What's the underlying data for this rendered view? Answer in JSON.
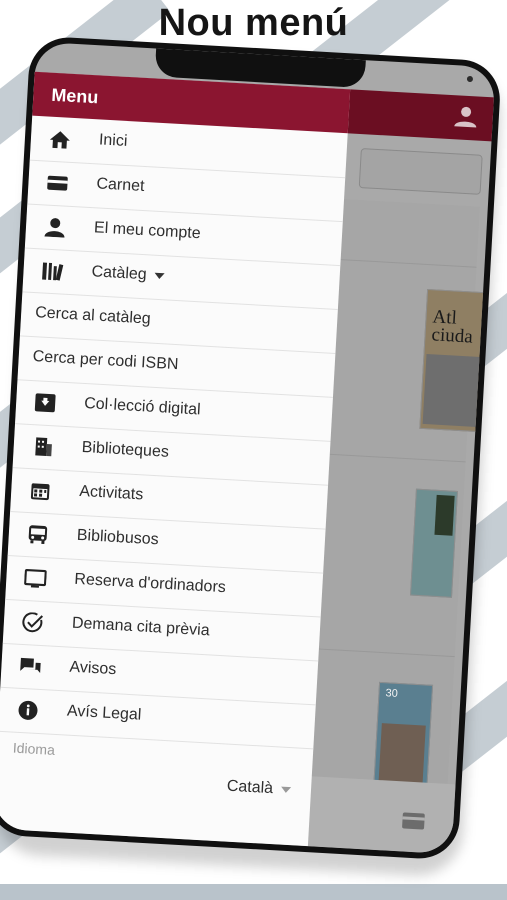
{
  "headline": "Nou menú",
  "drawer": {
    "title": "Menu",
    "items": [
      {
        "label": "Inici",
        "icon": "home-icon"
      },
      {
        "label": "Carnet",
        "icon": "card-icon"
      },
      {
        "label": "El meu compte",
        "icon": "user-icon"
      },
      {
        "label": "Catàleg",
        "icon": "books-icon"
      },
      {
        "label": "Cerca al catàleg",
        "icon": ""
      },
      {
        "label": "Cerca per codi ISBN",
        "icon": ""
      },
      {
        "label": "Col·lecció digital",
        "icon": "archive-box-icon"
      },
      {
        "label": "Biblioteques",
        "icon": "building-icon"
      },
      {
        "label": "Activitats",
        "icon": "calendar-icon"
      },
      {
        "label": "Bibliobusos",
        "icon": "bus-icon"
      },
      {
        "label": "Reserva d'ordinadors",
        "icon": "monitor-icon"
      },
      {
        "label": "Demana cita prèvia",
        "icon": "check-circle-icon"
      },
      {
        "label": "Avisos",
        "icon": "chat-bubbles-icon"
      },
      {
        "label": "Avís Legal",
        "icon": "info-icon"
      }
    ],
    "language_label": "Idioma",
    "language_value": "Català"
  },
  "background": {
    "book1_title": "Atl ciuda",
    "book3_number": "30"
  },
  "colors": {
    "drawer_header": "#8b1530",
    "app_header_dimmed": "#6b0e22",
    "stripes": "#c5cdd3"
  }
}
